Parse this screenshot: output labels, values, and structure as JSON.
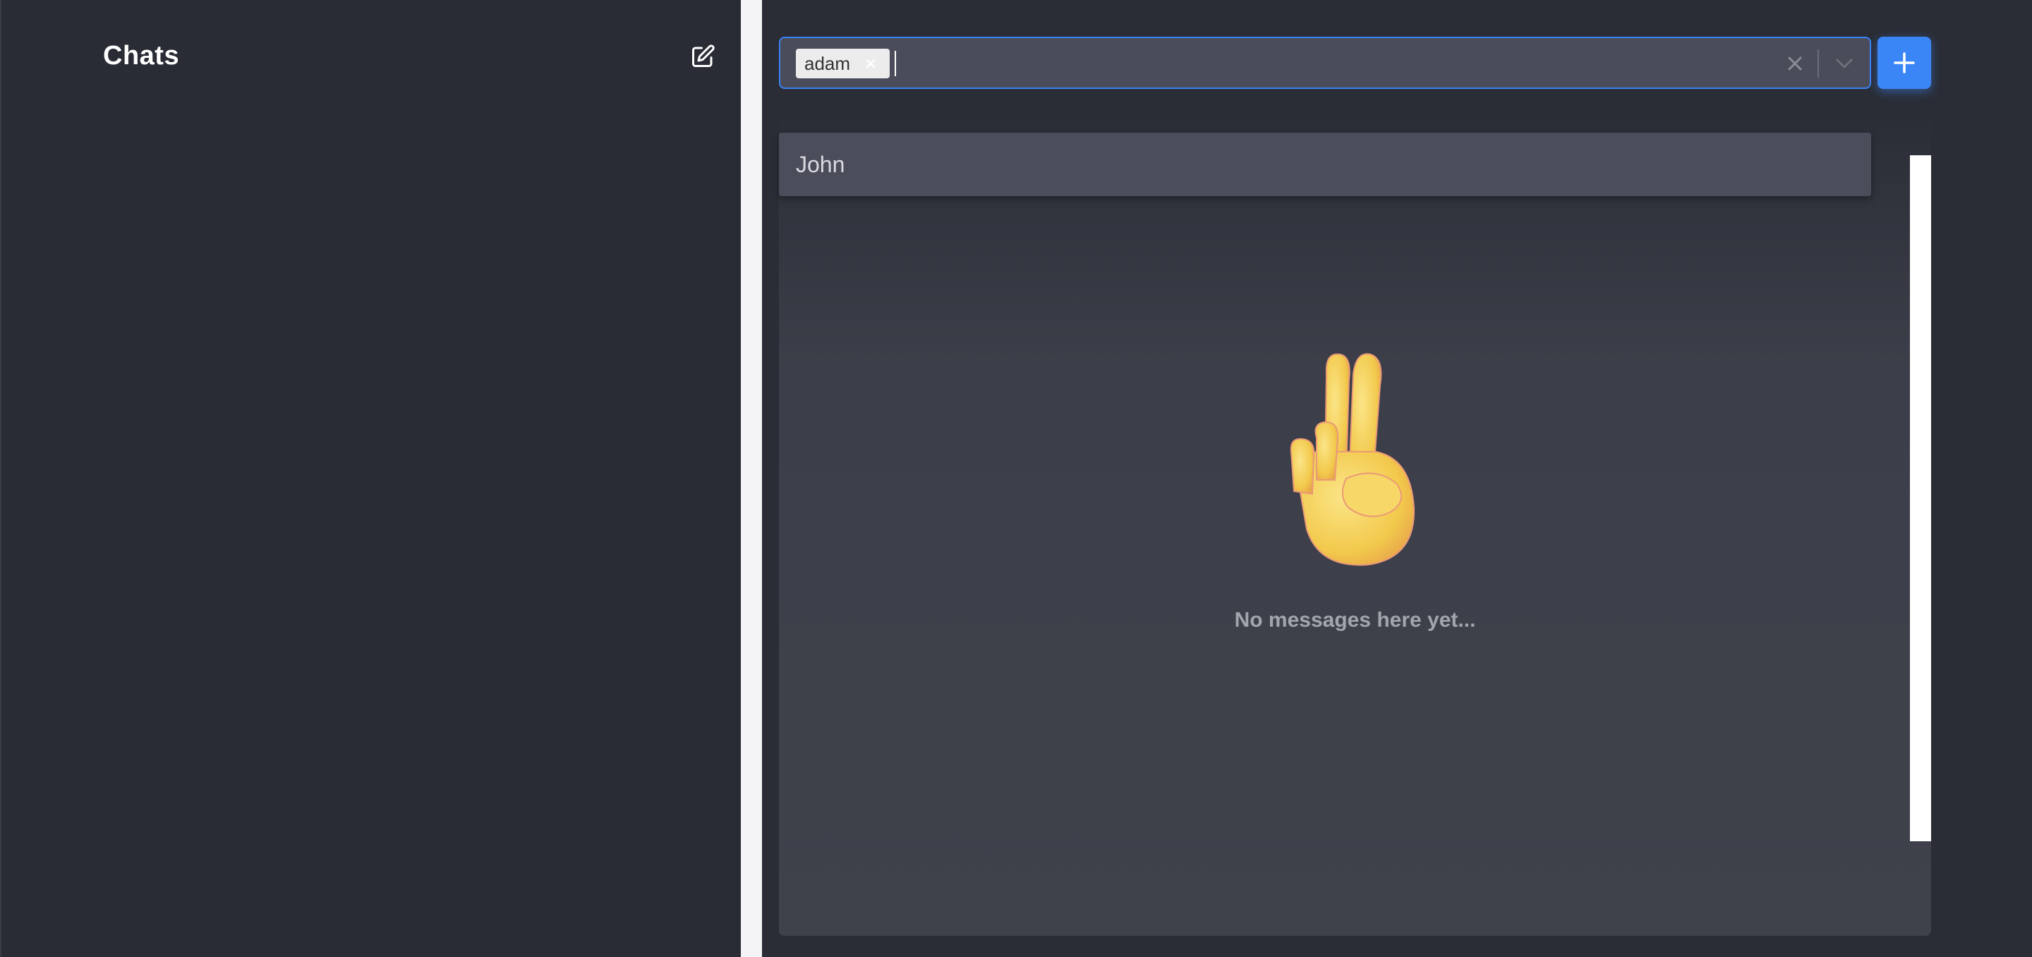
{
  "sidebar": {
    "title": "Chats",
    "compose_icon": "compose-icon"
  },
  "recipient_select": {
    "selected": [
      {
        "label": "adam",
        "remove_icon": "close-icon"
      }
    ],
    "input_value": "",
    "clear_icon": "close-icon",
    "dropdown_icon": "chevron-down-icon",
    "focused": true,
    "accent_color": "#3b82f6"
  },
  "add_button": {
    "icon": "plus-icon",
    "color": "#3b86f6"
  },
  "dropdown_menu": {
    "options": [
      {
        "label": "John"
      }
    ]
  },
  "chat": {
    "empty_emoji": "victory-hand",
    "empty_text": "No messages here yet..."
  }
}
